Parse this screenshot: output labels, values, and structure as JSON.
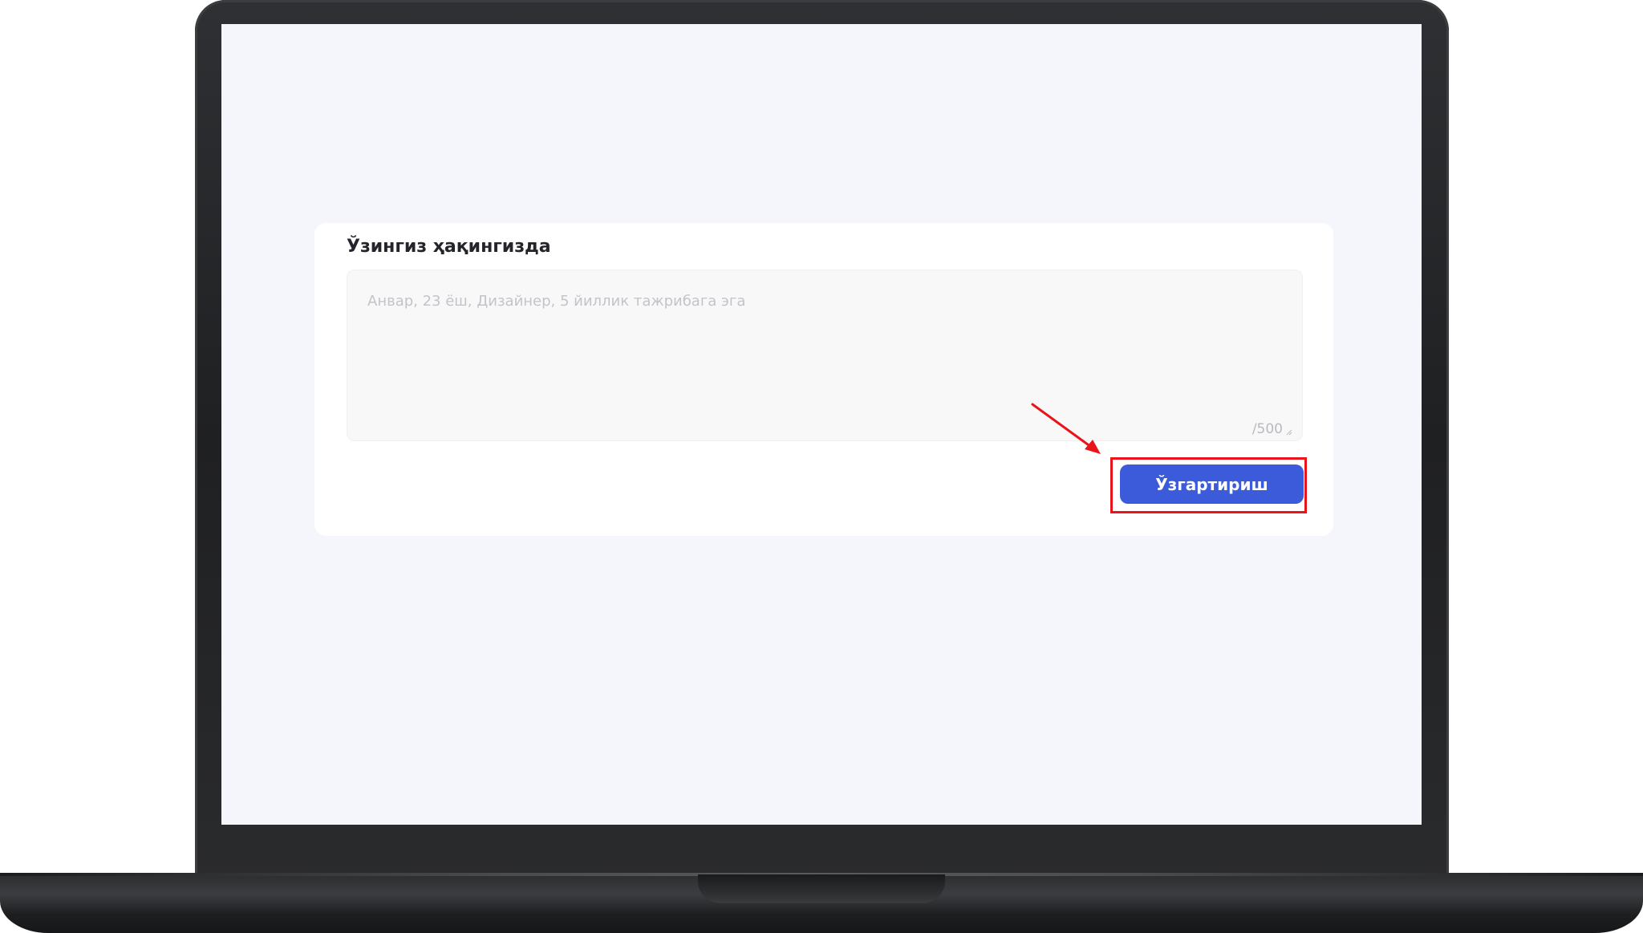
{
  "form": {
    "title": "Ўзингиз ҳақингизда",
    "textarea": {
      "value": "",
      "placeholder": "Анвар, 23 ёш, Дизайнер, 5 йиллик тажрибага эга"
    },
    "counter": "/500",
    "submit_label": "Ўзгартириш"
  },
  "colors": {
    "screen_background": "#f5f6fc",
    "card_background": "#ffffff",
    "button": "#3b5bdb",
    "annotation": "#e8141a"
  },
  "icons": {
    "resize_handle": "resize-handle-icon",
    "annotation_arrow": "arrow-icon"
  }
}
